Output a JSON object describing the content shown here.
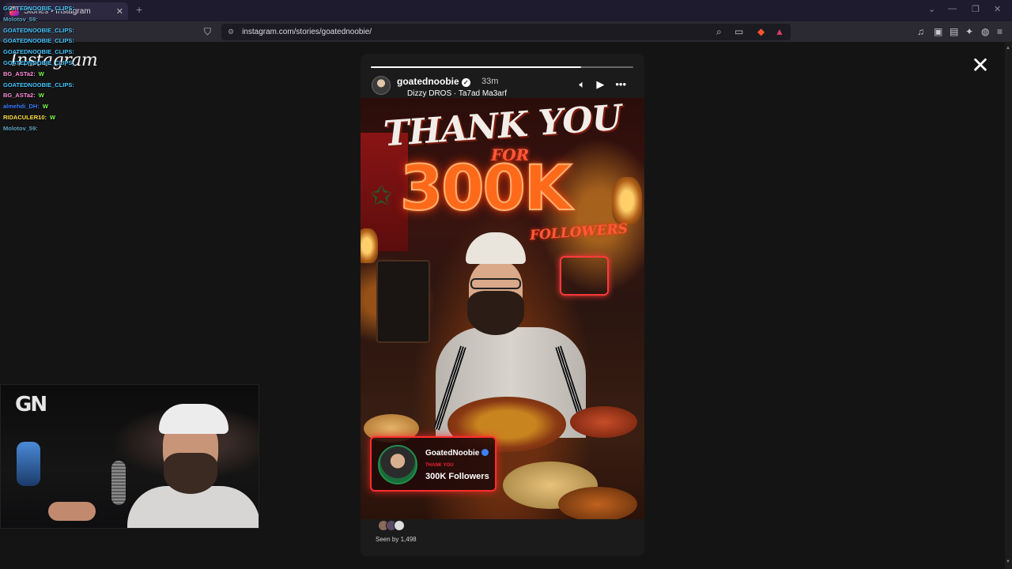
{
  "browser": {
    "tab_title": "Stories • Instagram",
    "url": "instagram.com/stories/goatednoobie/"
  },
  "page": {
    "logo": "Instagram"
  },
  "story": {
    "progress": 0.8,
    "username": "goatednoobie",
    "time_ago": "33m",
    "music": "Dizzy DROS · Ta7ad Ma3arf",
    "image": {
      "headline_line1": "THANK YOU",
      "headline_for": "FOR",
      "headline_number": "300K",
      "headline_followers": "FOLLOWERS"
    },
    "badge": {
      "name": "GoatedNoobie",
      "subtitle": "THANK YOU",
      "count": "300K Followers"
    },
    "seen_by": "Seen by 1,498"
  },
  "chat": [
    {
      "user": "GOATEDNOOBIE_CLIPS:",
      "msg": "",
      "color": "#46c6ff"
    },
    {
      "user": "Molotov_59:",
      "msg": "",
      "color": "#5fa7c4"
    },
    {
      "user": "GOATEDNOOBIE_CLIPS:",
      "msg": "",
      "color": "#46c6ff"
    },
    {
      "user": "GOATEDNOOBIE_CLIPS:",
      "msg": "",
      "color": "#46c6ff"
    },
    {
      "user": "GOATEDNOOBIE_CLIPS:",
      "msg": "",
      "color": "#46c6ff"
    },
    {
      "user": "GOATEDNOOBIE_CLIPS:",
      "msg": "",
      "color": "#46c6ff"
    },
    {
      "user": "BG_ASTa2:",
      "msg": "W",
      "color": "#ff8ed8"
    },
    {
      "user": "GOATEDNOOBIE_CLIPS:",
      "msg": "",
      "color": "#46c6ff"
    },
    {
      "user": "BG_ASTa2:",
      "msg": "W",
      "color": "#ff8ed8"
    },
    {
      "user": "almehdi_DH:",
      "msg": "W",
      "color": "#3f7bff"
    },
    {
      "user": "RIDACULER10:",
      "msg": "W",
      "color": "#ffe14a"
    },
    {
      "user": "Molotov_59:",
      "msg": "",
      "color": "#5fa7c4"
    }
  ],
  "webcam": {
    "logo": "GN"
  }
}
